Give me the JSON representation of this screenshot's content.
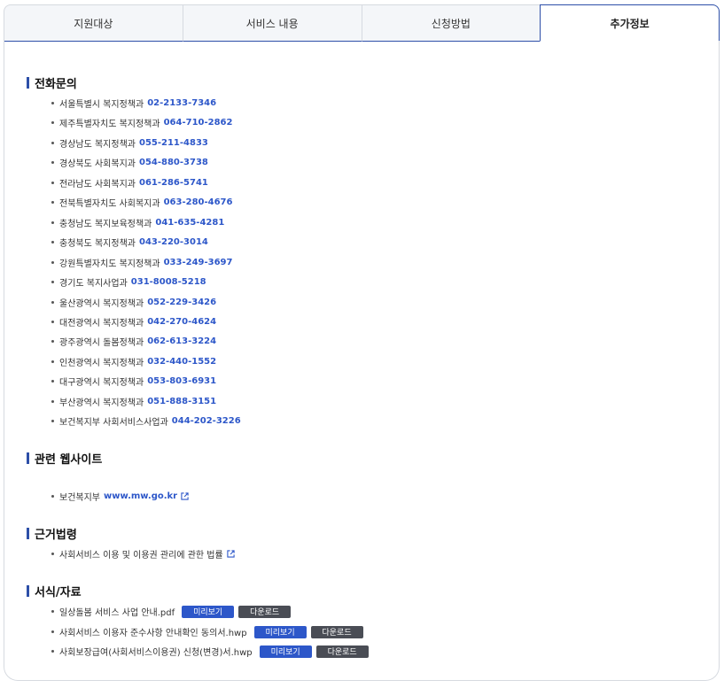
{
  "tabs": [
    {
      "label": "지원대상"
    },
    {
      "label": "서비스 내용"
    },
    {
      "label": "신청방법"
    },
    {
      "label": "추가정보"
    }
  ],
  "sections": {
    "contact": {
      "title": "전화문의",
      "items": [
        {
          "org": "서울특별시 복지정책과",
          "phone": "02-2133-7346"
        },
        {
          "org": "제주특별자치도 복지정책과",
          "phone": "064-710-2862"
        },
        {
          "org": "경상남도 복지정책과",
          "phone": "055-211-4833"
        },
        {
          "org": "경상북도 사회복지과",
          "phone": "054-880-3738"
        },
        {
          "org": "전라남도 사회복지과",
          "phone": "061-286-5741"
        },
        {
          "org": "전북특별자치도 사회복지과",
          "phone": "063-280-4676"
        },
        {
          "org": "충청남도 복지보육정책과",
          "phone": "041-635-4281"
        },
        {
          "org": "충청북도 복지정책과",
          "phone": "043-220-3014"
        },
        {
          "org": "강원특별자치도 복지정책과",
          "phone": "033-249-3697"
        },
        {
          "org": "경기도 복지사업과",
          "phone": "031-8008-5218"
        },
        {
          "org": "울산광역시 복지정책과",
          "phone": "052-229-3426"
        },
        {
          "org": "대전광역시 복지정책과",
          "phone": "042-270-4624"
        },
        {
          "org": "광주광역시 돌봄정책과",
          "phone": "062-613-3224"
        },
        {
          "org": "인천광역시 복지정책과",
          "phone": "032-440-1552"
        },
        {
          "org": "대구광역시 복지정책과",
          "phone": "053-803-6931"
        },
        {
          "org": "부산광역시 복지정책과",
          "phone": "051-888-3151"
        },
        {
          "org": "보건복지부 사회서비스사업과",
          "phone": "044-202-3226"
        }
      ]
    },
    "websites": {
      "title": "관련 웹사이트",
      "items": [
        {
          "label": "보건복지부",
          "url": "www.mw.go.kr",
          "icon": "external-link-icon"
        }
      ]
    },
    "laws": {
      "title": "근거법령",
      "items": [
        {
          "label": "사회서비스 이용 및 이용권 관리에 관한 법률",
          "icon": "external-link-icon"
        }
      ]
    },
    "forms": {
      "title": "서식/자료",
      "preview_label": "미리보기",
      "download_label": "다운로드",
      "items": [
        {
          "name": "일상돌봄 서비스 사업 안내.pdf"
        },
        {
          "name": "사회서비스 이용자 준수사항 안내확인 동의서.hwp"
        },
        {
          "name": "사회보장급여(사회서비스이용권) 신청(변경)서.hwp"
        }
      ]
    }
  },
  "colors": {
    "accent": "#2d57c9",
    "download_btn": "#4a4d55"
  }
}
